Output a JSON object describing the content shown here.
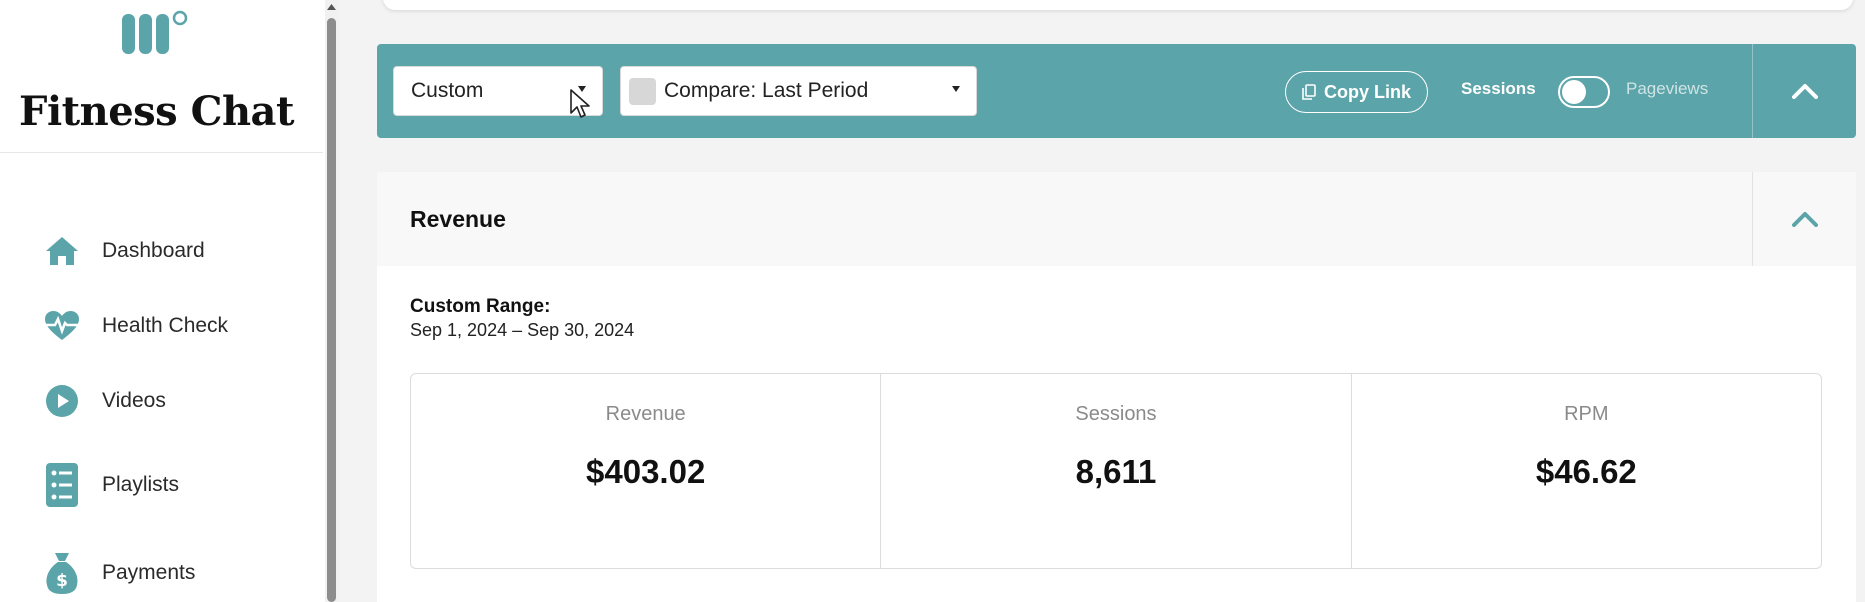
{
  "brand": {
    "name": "Fitness Chat",
    "accent": "#5ba4a9"
  },
  "sidebar": {
    "items": [
      {
        "label": "Dashboard",
        "icon": "home-icon"
      },
      {
        "label": "Health Check",
        "icon": "heartbeat-icon"
      },
      {
        "label": "Videos",
        "icon": "play-circle-icon"
      },
      {
        "label": "Playlists",
        "icon": "checklist-icon"
      },
      {
        "label": "Payments",
        "icon": "money-bag-icon"
      }
    ]
  },
  "toolbar": {
    "range_select": {
      "value": "Custom"
    },
    "compare_select": {
      "value": "Compare: Last Period"
    },
    "copy_link_label": "Copy Link",
    "toggle": {
      "on_label": "Sessions",
      "off_label": "Pageviews",
      "state": "Sessions"
    }
  },
  "revenue": {
    "title": "Revenue",
    "range_label": "Custom Range:",
    "range_value": "Sep 1, 2024 – Sep 30, 2024",
    "stats": [
      {
        "label": "Revenue",
        "value": "$403.02"
      },
      {
        "label": "Sessions",
        "value": "8,611"
      },
      {
        "label": "RPM",
        "value": "$46.62"
      }
    ]
  }
}
